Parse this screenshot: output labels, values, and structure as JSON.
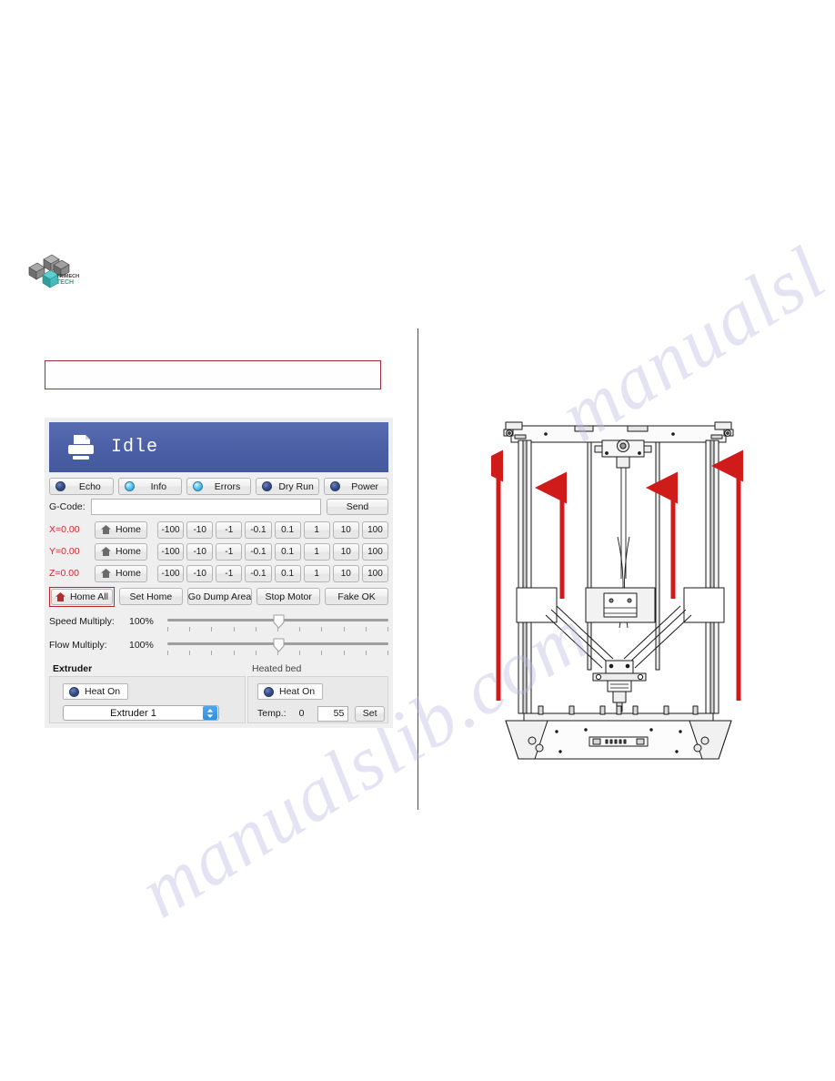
{
  "watermark": {
    "line1": "manualsl",
    "line2": "manualslib.com"
  },
  "logo": {
    "name": "trimech-tech-logo",
    "text_top": "TRIMECH",
    "text_bottom": "TECH"
  },
  "note_box": {
    "text": ""
  },
  "app": {
    "header": {
      "status": "Idle",
      "icon": "printer-icon"
    },
    "leds": [
      {
        "label": "Echo",
        "state": "off"
      },
      {
        "label": "Info",
        "state": "on"
      },
      {
        "label": "Errors",
        "state": "on"
      },
      {
        "label": "Dry Run",
        "state": "off"
      },
      {
        "label": "Power",
        "state": "off"
      }
    ],
    "gcode": {
      "label": "G-Code:",
      "value": "",
      "placeholder": "",
      "send_label": "Send"
    },
    "axes": [
      {
        "readout": "X=0.00",
        "home_label": "Home",
        "jog": [
          "-100",
          "-10",
          "-1",
          "-0.1",
          "0.1",
          "1",
          "10",
          "100"
        ]
      },
      {
        "readout": "Y=0.00",
        "home_label": "Home",
        "jog": [
          "-100",
          "-10",
          "-1",
          "-0.1",
          "0.1",
          "1",
          "10",
          "100"
        ]
      },
      {
        "readout": "Z=0.00",
        "home_label": "Home",
        "jog": [
          "-100",
          "-10",
          "-1",
          "-0.1",
          "0.1",
          "1",
          "10",
          "100"
        ]
      }
    ],
    "actions": {
      "home_all": "Home All",
      "set_home": "Set Home",
      "go_dump_area": "Go Dump Area",
      "stop_motor": "Stop Motor",
      "fake_ok": "Fake OK"
    },
    "sliders": [
      {
        "label": "Speed Multiply:",
        "value": "100%",
        "position_pct": 50
      },
      {
        "label": "Flow Multiply:",
        "value": "100%",
        "position_pct": 50
      }
    ],
    "extruder": {
      "section_label": "Extruder",
      "heat_label": "Heat On",
      "selected": "Extruder 1"
    },
    "heated_bed": {
      "section_label": "Heated bed",
      "heat_label": "Heat On",
      "temp_label": "Temp.:",
      "temp_current": "0",
      "temp_target": "55",
      "set_label": "Set"
    }
  },
  "figure": {
    "name": "delta-3d-printer-diagram",
    "arrow_count": 4,
    "arrow_color": "#d01b1b",
    "caption": ""
  },
  "colors": {
    "header_blue": "#4a5fa5",
    "accent_red": "#c0222b",
    "axis_red": "#cf2a2a",
    "led_on": "#5fc8f0",
    "led_off": "#3b4f8c",
    "panel_gray": "#efefef"
  }
}
